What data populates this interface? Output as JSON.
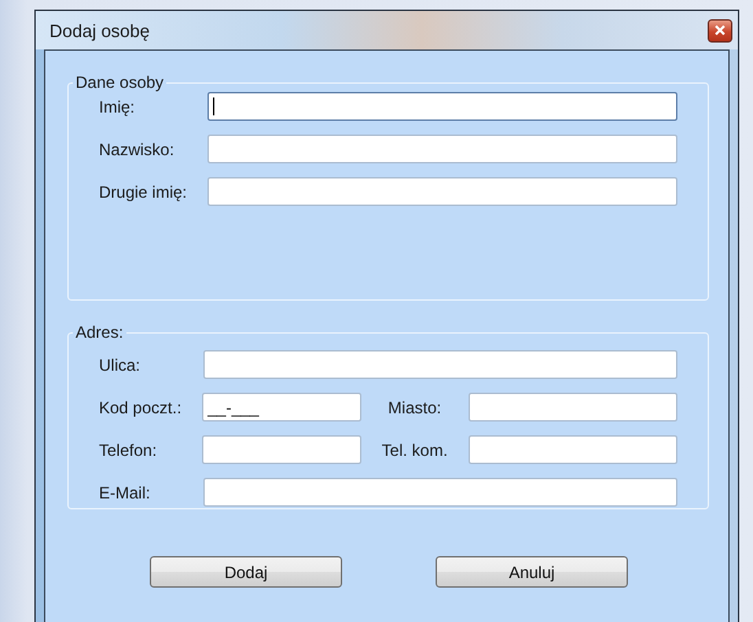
{
  "window": {
    "title": "Dodaj osobę"
  },
  "person_group": {
    "legend": "Dane osoby",
    "fields": [
      {
        "label": "Imię:",
        "focused": true
      },
      {
        "label": "Nazwisko:",
        "focused": false
      },
      {
        "label": "Drugie imię:",
        "focused": false
      }
    ]
  },
  "address_group": {
    "legend": "Adres:",
    "rows": [
      {
        "fields": [
          {
            "label": "Ulica:"
          }
        ]
      },
      {
        "fields": [
          {
            "label": "Kod poczt.:",
            "value": "__-___"
          },
          {
            "label": "Miasto:"
          }
        ]
      },
      {
        "fields": [
          {
            "label": "Telefon:"
          },
          {
            "label": "Tel. kom."
          }
        ]
      },
      {
        "fields": [
          {
            "label": "E-Mail:"
          }
        ]
      }
    ]
  },
  "buttons": [
    "Dodaj",
    "Anuluj"
  ]
}
